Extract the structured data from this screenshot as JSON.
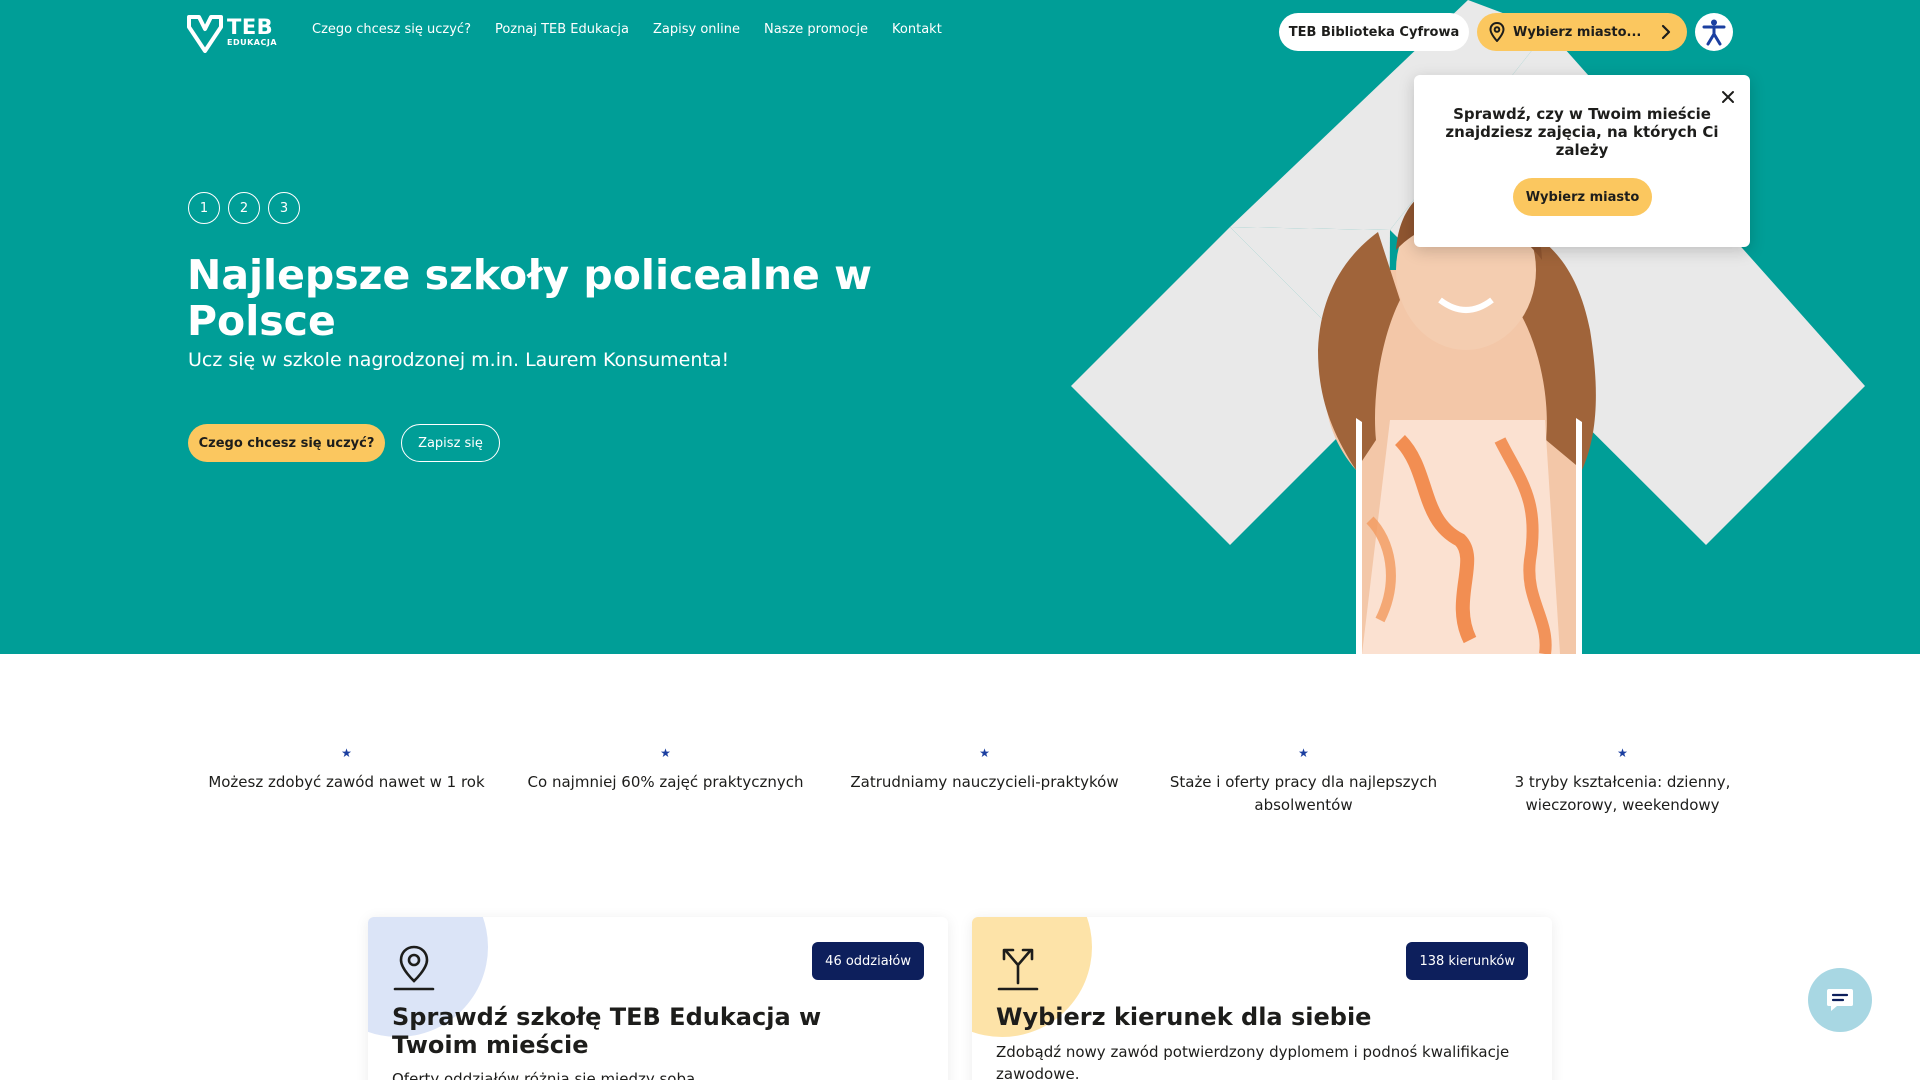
{
  "brand": {
    "logo_text": "TEB",
    "logo_sub": "EDUKACJA"
  },
  "nav": {
    "links": [
      "Czego chcesz się uczyć?",
      "Poznaj TEB Edukacja",
      "Zapisy online",
      "Nasze promocje",
      "Kontakt"
    ],
    "library_button": "TEB Biblioteka Cyfrowa",
    "city_button": "Wybierz miasto...",
    "accessibility_icon": "accessibility-icon"
  },
  "hero": {
    "slides": [
      "1",
      "2",
      "3"
    ],
    "title": "Najlepsze szkoły policealne w Polsce",
    "subtitle": "Ucz się w szkole nagrodzonej m.in. Laurem Konsumenta!",
    "primary_button": "Czego chcesz się uczyć?",
    "secondary_button": "Zapisz się"
  },
  "popup": {
    "text": "Sprawdź, czy w Twoim mieście znajdziesz zajęcia, na których Ci zależy",
    "button": "Wybierz miasto"
  },
  "features": [
    {
      "icon": "star-icon",
      "text": "Możesz zdobyć zawód nawet w 1 rok"
    },
    {
      "icon": "star-icon",
      "text": "Co najmniej 60% zajęć praktycznych"
    },
    {
      "icon": "star-icon",
      "text": "Zatrudniamy nauczycieli-praktyków"
    },
    {
      "icon": "star-icon",
      "text": "Staże i oferty pracy dla najlepszych absolwentów"
    },
    {
      "icon": "star-icon",
      "text": "3 tryby kształcenia: dzienny, wieczorowy, weekendowy"
    }
  ],
  "cards": [
    {
      "icon": "location-pin-icon",
      "badge": "46 oddziałów",
      "title": "Sprawdź szkołę TEB Edukacja w Twoim mieście",
      "text": "Oferty oddziałów różnią się między sobą"
    },
    {
      "icon": "split-arrows-icon",
      "badge": "138 kierunków",
      "title": "Wybierz kierunek dla siebie",
      "text": "Zdobądź nowy zawód potwierdzony dyplomem i podnoś kwalifikacje zawodowe."
    }
  ],
  "colors": {
    "brand_teal": "#009e97",
    "accent_yellow": "#fbc75f",
    "badge_navy": "#0d1f5c",
    "star_blue": "#1b3fa0",
    "card_blob_blue": "#dbe4f7",
    "card_blob_yellow": "#fde3a8"
  },
  "chat": {
    "icon": "chat-icon"
  }
}
